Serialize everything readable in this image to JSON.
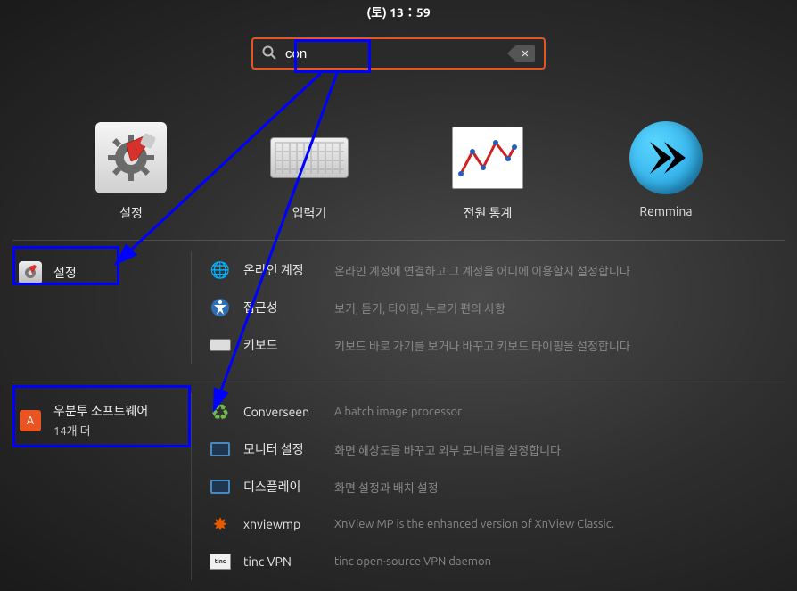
{
  "topbar": {
    "clock": "(토) 13：59"
  },
  "search": {
    "value": "con"
  },
  "apps": [
    {
      "label": "설정",
      "icon": "settings"
    },
    {
      "label": "입력기",
      "icon": "keyboard"
    },
    {
      "label": "전원 통계",
      "icon": "power-stats"
    },
    {
      "label": "Remmina",
      "icon": "remmina"
    }
  ],
  "settings_section": {
    "title": "설정",
    "rows": [
      {
        "name": "온라인 계정",
        "desc": "온라인 계정에 연결하고 그 계정을 어디에 이용할지 설정합니다",
        "icon": "globe"
      },
      {
        "name": "접근성",
        "desc": "보기, 듣기, 타이핑, 누르기 편의 사항",
        "icon": "access"
      },
      {
        "name": "키보드",
        "desc": "키보드 바로 가기를 보거나 바꾸고 키보드 타이핑을 설정합니다",
        "icon": "kb"
      }
    ]
  },
  "software_section": {
    "title": "우분투 소프트웨어",
    "more": "14개 더",
    "rows": [
      {
        "name": "Converseen",
        "desc": "A batch image processor",
        "icon": "recycle"
      },
      {
        "name": "모니터 설정",
        "desc": "화면 해상도를 바꾸고 외부 모니터를 설정합니다",
        "icon": "monitor"
      },
      {
        "name": "디스플레이",
        "desc": "화면 설정과 배치 설정",
        "icon": "monitor"
      },
      {
        "name": "xnviewmp",
        "desc": "XnView MP is the enhanced version of XnView Classic.",
        "icon": "xnfire"
      },
      {
        "name": "tinc VPN",
        "desc": "tinc open-source VPN daemon",
        "icon": "tinc"
      }
    ]
  }
}
